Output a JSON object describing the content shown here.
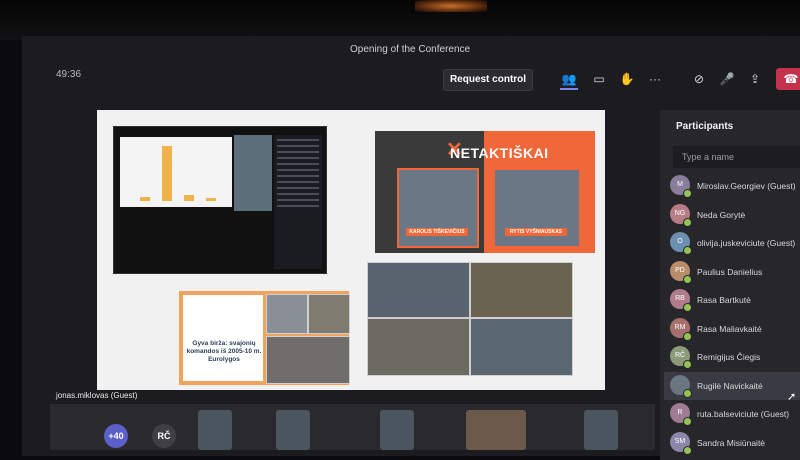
{
  "meeting": {
    "title": "Opening of the Conference",
    "timer": "49:36",
    "request_control_label": "Request control"
  },
  "toolbar": {
    "icons": [
      "participants-icon",
      "chat-icon",
      "raise-hand-icon",
      "more-icon",
      "camera-off-icon",
      "mic-off-icon",
      "share-icon",
      "hang-up-icon"
    ]
  },
  "stage": {
    "logo_text": "NETAKTIŠKAI",
    "guest_left": "KAROLIS TIŠKEVIČIUS",
    "guest_right": "RYTIS VYŠNIAUSKAS",
    "basket_title": "Gyva birža: svajonių komandos iš 2005-10 m. Eurolygos",
    "basket_brand": "BASKETNEWS.LT",
    "mini_brand": "PROTMŪŠIS"
  },
  "active_video": {
    "label": "jonas.miklovas (Guest)"
  },
  "bottom_strip": {
    "overflow_count": "+40",
    "initials": "RČ"
  },
  "participants": {
    "heading": "Participants",
    "search_placeholder": "Type a name",
    "list": [
      {
        "initials": "M",
        "name": "Miroslav.Georgiev (Guest)",
        "color": "#8a7c9b"
      },
      {
        "initials": "NG",
        "name": "Neda Gorytė",
        "color": "#b87c85"
      },
      {
        "initials": "O",
        "name": "olivija.juskeviciute (Guest)",
        "color": "#6d8fb0"
      },
      {
        "initials": "PD",
        "name": "Paulius Danielius",
        "color": "#b98d6a"
      },
      {
        "initials": "RB",
        "name": "Rasa Bartkutė",
        "color": "#b07b8a"
      },
      {
        "initials": "RM",
        "name": "Rasa Maliavkaitė",
        "color": "#a6706f"
      },
      {
        "initials": "RČ",
        "name": "Remigijus Čiegis",
        "color": "#8b9b7a"
      },
      {
        "initials": "",
        "name": "Rugilė Navickaitė",
        "color": "#6b7580"
      },
      {
        "initials": "R",
        "name": "ruta.balseviciute (Guest)",
        "color": "#a07c94"
      },
      {
        "initials": "SM",
        "name": "Sandra Misiūnaitė",
        "color": "#8c86a8"
      }
    ]
  }
}
